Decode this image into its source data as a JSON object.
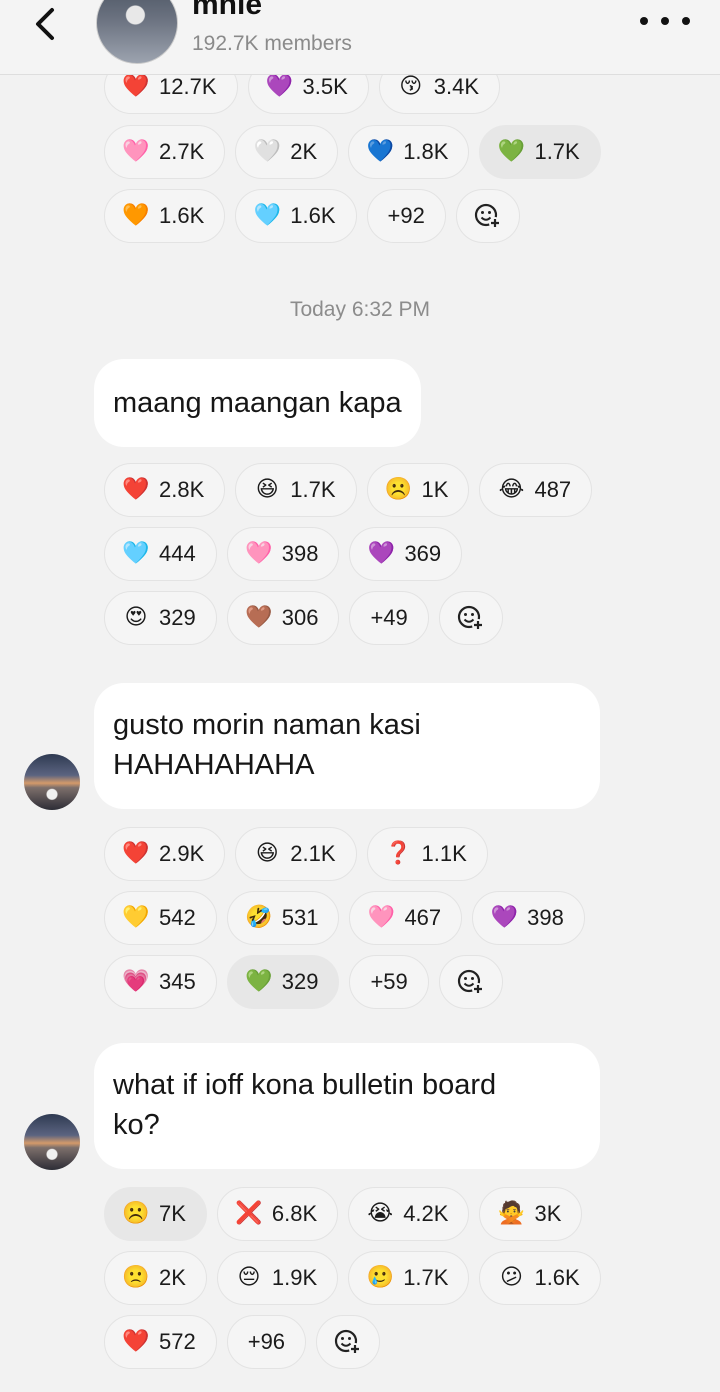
{
  "header": {
    "title": "mnie",
    "members": "192.7K members",
    "back_icon": "chevron-left-icon",
    "more_icon": "more-horizontal-icon"
  },
  "top_reactions": {
    "row1": [
      {
        "emoji": "❤️",
        "count": "12.7K"
      },
      {
        "emoji": "💜",
        "count": "3.5K"
      },
      {
        "emoji": "😚",
        "count": "3.4K"
      }
    ],
    "row2": [
      {
        "emoji": "🩷",
        "count": "2.7K"
      },
      {
        "emoji": "🤍",
        "count": "2K"
      },
      {
        "emoji": "💙",
        "count": "1.8K"
      },
      {
        "emoji": "💚",
        "count": "1.7K"
      }
    ],
    "row3": [
      {
        "emoji": "🧡",
        "count": "1.6K"
      },
      {
        "emoji": "🩵",
        "count": "1.6K"
      }
    ],
    "more": "+92"
  },
  "timestamp": "Today 6:32 PM",
  "messages": [
    {
      "text": "maang maangan kapa",
      "reactions": {
        "row1": [
          {
            "emoji": "❤️",
            "count": "2.8K"
          },
          {
            "emoji": "😆",
            "count": "1.7K"
          },
          {
            "emoji": "☹️",
            "count": "1K"
          },
          {
            "emoji": "😂",
            "count": "487"
          }
        ],
        "row2": [
          {
            "emoji": "🩵",
            "count": "444"
          },
          {
            "emoji": "🩷",
            "count": "398"
          },
          {
            "emoji": "💜",
            "count": "369"
          }
        ],
        "row3": [
          {
            "emoji": "😍",
            "count": "329"
          },
          {
            "emoji": "🤎",
            "count": "306"
          }
        ],
        "more": "+49"
      }
    },
    {
      "text_line1": "gusto morin naman kasi",
      "text_line2": "HAHAHAHAHA",
      "reactions": {
        "row1": [
          {
            "emoji": "❤️",
            "count": "2.9K"
          },
          {
            "emoji": "😆",
            "count": "2.1K"
          },
          {
            "emoji": "❓",
            "count": "1.1K"
          }
        ],
        "row2": [
          {
            "emoji": "💛",
            "count": "542"
          },
          {
            "emoji": "🤣",
            "count": "531"
          },
          {
            "emoji": "🩷",
            "count": "467"
          },
          {
            "emoji": "💜",
            "count": "398"
          }
        ],
        "row3": [
          {
            "emoji": "💗",
            "count": "345"
          },
          {
            "emoji": "💚",
            "count": "329"
          }
        ],
        "more": "+59"
      }
    },
    {
      "text_line1": "what if ioff kona bulletin board",
      "text_line2": "ko?",
      "reactions": {
        "row1": [
          {
            "emoji": "☹️",
            "count": "7K"
          },
          {
            "emoji": "❌",
            "count": "6.8K"
          },
          {
            "emoji": "😭",
            "count": "4.2K"
          },
          {
            "emoji": "🙅",
            "count": "3K"
          }
        ],
        "row2": [
          {
            "emoji": "🙁",
            "count": "2K"
          },
          {
            "emoji": "😔",
            "count": "1.9K"
          },
          {
            "emoji": "🥲",
            "count": "1.7K"
          },
          {
            "emoji": "😕",
            "count": "1.6K"
          }
        ],
        "row3": [
          {
            "emoji": "❤️",
            "count": "572"
          }
        ],
        "more": "+96"
      }
    }
  ],
  "colors": {
    "background": "#f2f2f2",
    "bubble": "#ffffff",
    "chip_selected": "#e7e7e7"
  }
}
